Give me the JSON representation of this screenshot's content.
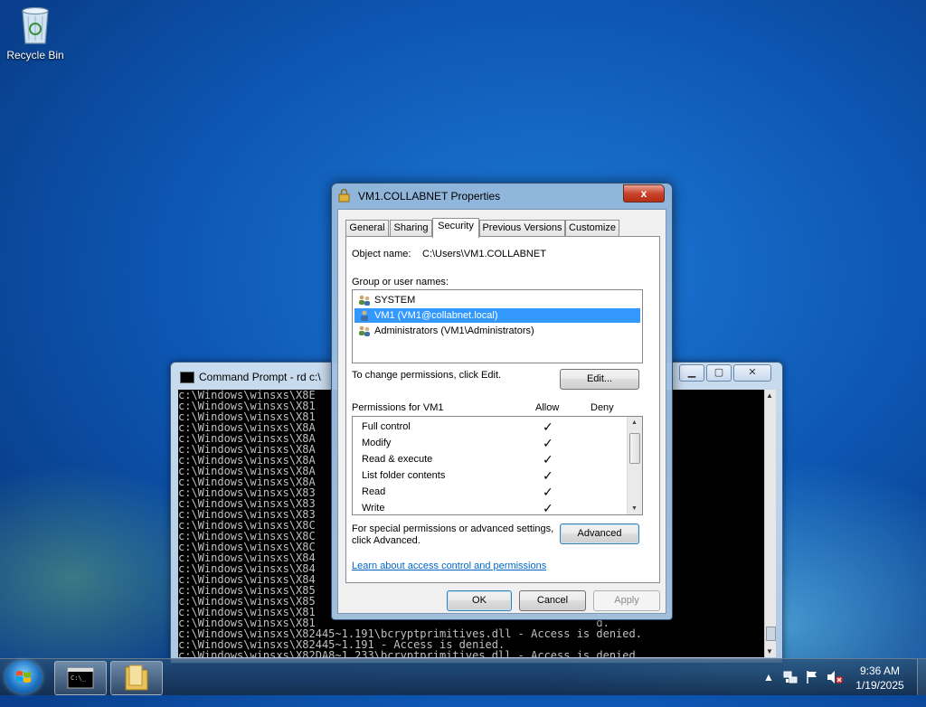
{
  "desktop": {
    "recycle_bin_label": "Recycle Bin"
  },
  "cmd_window": {
    "title": "Command Prompt - rd  c:\\",
    "lines": [
      "c:\\Windows\\winsxs\\X8E",
      "c:\\Windows\\winsxs\\X81",
      "c:\\Windows\\winsxs\\X81",
      "c:\\Windows\\winsxs\\X8A",
      "c:\\Windows\\winsxs\\X8A",
      "c:\\Windows\\winsxs\\X8A",
      "c:\\Windows\\winsxs\\X8A",
      "c:\\Windows\\winsxs\\X8A",
      "c:\\Windows\\winsxs\\X8A",
      "c:\\Windows\\winsxs\\X83",
      "c:\\Windows\\winsxs\\X83",
      "c:\\Windows\\winsxs\\X83",
      "c:\\Windows\\winsxs\\X8C",
      "c:\\Windows\\winsxs\\X8C",
      "c:\\Windows\\winsxs\\X8C",
      "c:\\Windows\\winsxs\\X84",
      "c:\\Windows\\winsxs\\X84",
      "c:\\Windows\\winsxs\\X84",
      "c:\\Windows\\winsxs\\X85",
      "c:\\Windows\\winsxs\\X85",
      "c:\\Windows\\winsxs\\X81                                           d.",
      "c:\\Windows\\winsxs\\X81                                           d.",
      "c:\\Windows\\winsxs\\X82445~1.191\\bcryptprimitives.dll - Access is denied.",
      "c:\\Windows\\winsxs\\X82445~1.191 - Access is denied.",
      "c:\\Windows\\winsxs\\X82DA8~1.233\\bcryptprimitives.dll - Access is denied."
    ]
  },
  "dialog": {
    "title": "VM1.COLLABNET Properties",
    "close_label": "x",
    "tabs": [
      "General",
      "Sharing",
      "Security",
      "Previous Versions",
      "Customize"
    ],
    "active_tab": "Security",
    "object_name_label": "Object name:",
    "object_name_value": "C:\\Users\\VM1.COLLABNET",
    "group_label": "Group or user names:",
    "users": [
      {
        "name": "SYSTEM",
        "icon": "group-users-icon",
        "selected": false
      },
      {
        "name": "VM1 (VM1@collabnet.local)",
        "icon": "user-icon",
        "selected": true
      },
      {
        "name": "Administrators (VM1\\Administrators)",
        "icon": "group-users-icon",
        "selected": false
      }
    ],
    "change_perm_text": "To change permissions, click Edit.",
    "edit_button": "Edit...",
    "permissions_for": "Permissions for VM1",
    "allow_label": "Allow",
    "deny_label": "Deny",
    "permissions": [
      {
        "name": "Full control",
        "allow": "✓",
        "deny": ""
      },
      {
        "name": "Modify",
        "allow": "✓",
        "deny": ""
      },
      {
        "name": "Read & execute",
        "allow": "✓",
        "deny": ""
      },
      {
        "name": "List folder contents",
        "allow": "✓",
        "deny": ""
      },
      {
        "name": "Read",
        "allow": "✓",
        "deny": ""
      },
      {
        "name": "Write",
        "allow": "✓",
        "deny": ""
      }
    ],
    "special_perm_line1": "For special permissions or advanced settings,",
    "special_perm_line2": "click Advanced.",
    "advanced_button": "Advanced",
    "learn_link": "Learn about access control and permissions",
    "ok_button": "OK",
    "cancel_button": "Cancel",
    "apply_button": "Apply"
  },
  "taskbar": {
    "time": "9:36 AM",
    "date": "1/19/2025",
    "tray_arrow": "▲"
  },
  "colors": {
    "selection": "#3399ff",
    "link": "#0066cc",
    "close_button": "#c8452c"
  }
}
